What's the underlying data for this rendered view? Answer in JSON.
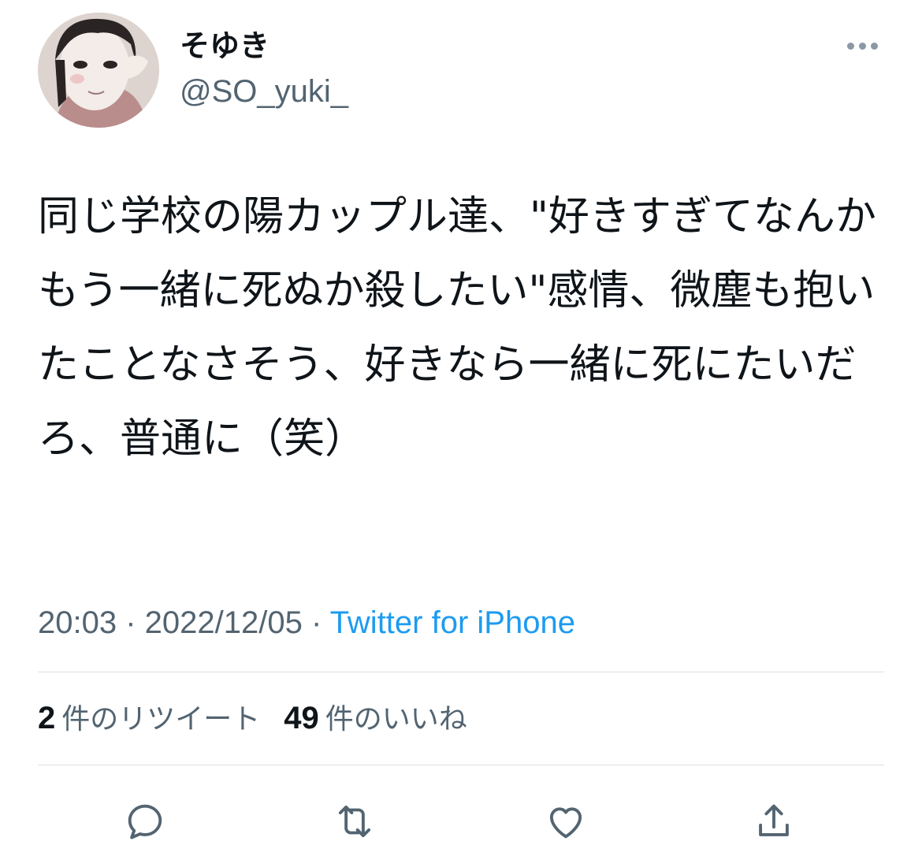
{
  "user": {
    "display_name": "そゆき",
    "handle": "@SO_yuki_"
  },
  "tweet": {
    "text": "同じ学校の陽カップル達、\"好きすぎてなんかもう一緒に死ぬか殺したい\"感情、微塵も抱いたことなさそう、好きなら一緒に死にたいだろ、普通に（笑）"
  },
  "meta": {
    "time": "20:03",
    "separator": " · ",
    "date": "2022/12/05",
    "source": "Twitter for iPhone"
  },
  "stats": {
    "retweets_count": "2",
    "retweets_label": "件のリツイート",
    "likes_count": "49",
    "likes_label": "件のいいね"
  },
  "actions": {
    "icons": [
      "reply-icon",
      "retweet-icon",
      "like-icon",
      "share-icon"
    ]
  },
  "colors": {
    "text_primary": "#0f1419",
    "text_secondary": "#536471",
    "link": "#1d9bf0",
    "divider": "#dcdfe2"
  }
}
